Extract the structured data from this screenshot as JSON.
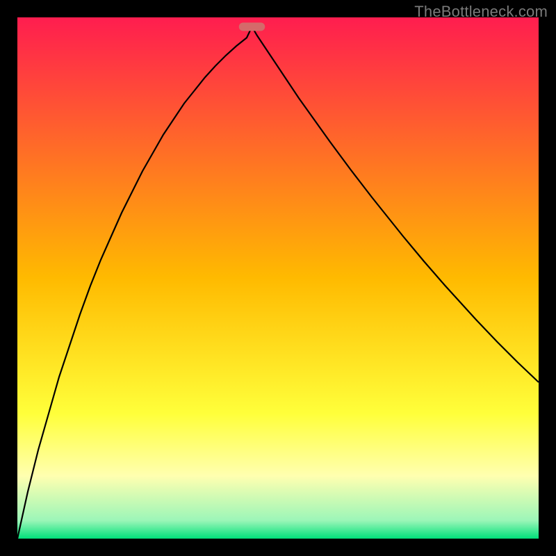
{
  "watermark": {
    "text": "TheBottleneck.com"
  },
  "chart_data": {
    "type": "line",
    "title": "",
    "xlabel": "",
    "ylabel": "",
    "xlim": [
      0,
      100
    ],
    "ylim": [
      0,
      100
    ],
    "legend": false,
    "grid": false,
    "background_gradient": {
      "stops": [
        {
          "offset": 0.0,
          "color": "#ff1d4f"
        },
        {
          "offset": 0.5,
          "color": "#ffba00"
        },
        {
          "offset": 0.76,
          "color": "#ffff3a"
        },
        {
          "offset": 0.88,
          "color": "#ffffb0"
        },
        {
          "offset": 0.965,
          "color": "#9cf6b8"
        },
        {
          "offset": 1.0,
          "color": "#00e07a"
        }
      ]
    },
    "marker": {
      "x": 45,
      "y": 98.2,
      "width": 5,
      "height": 1.6,
      "color": "#d46a6a"
    },
    "curve": {
      "description": "V-shaped bottleneck curve with minimum near x≈45",
      "x": [
        0,
        2,
        4,
        6,
        8,
        10,
        12,
        14,
        16,
        18,
        20,
        22,
        24,
        26,
        28,
        30,
        32,
        34,
        36,
        38,
        40,
        42,
        44,
        45,
        46,
        48,
        50,
        52,
        54,
        56,
        58,
        60,
        62,
        64,
        66,
        68,
        70,
        72,
        74,
        76,
        78,
        80,
        82,
        84,
        86,
        88,
        90,
        92,
        94,
        96,
        98,
        100
      ],
      "y": [
        0,
        9,
        17,
        24,
        31,
        37,
        43,
        48.5,
        53.5,
        58,
        62.5,
        66.5,
        70.5,
        74,
        77.5,
        80.5,
        83.5,
        86,
        88.5,
        90.7,
        92.7,
        94.5,
        96.1,
        98.2,
        96.5,
        93.5,
        90.5,
        87.5,
        84.5,
        81.7,
        78.9,
        76.1,
        73.4,
        70.7,
        68.1,
        65.5,
        63,
        60.5,
        58,
        55.6,
        53.2,
        50.9,
        48.6,
        46.4,
        44.2,
        42,
        39.9,
        37.8,
        35.8,
        33.8,
        31.9,
        30
      ]
    }
  }
}
